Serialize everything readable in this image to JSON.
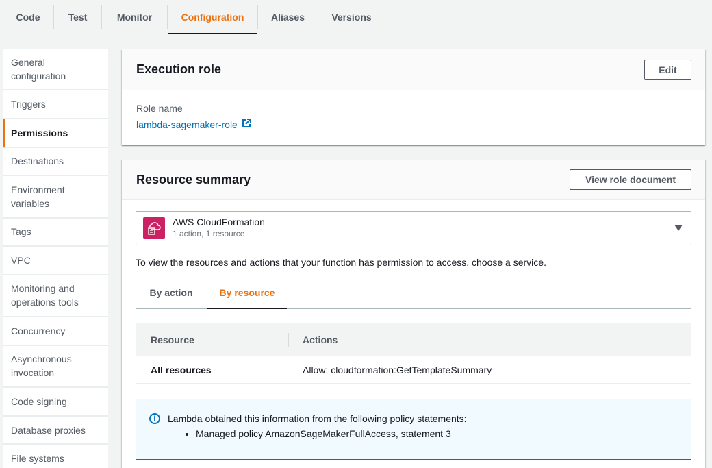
{
  "top_tabs": [
    {
      "label": "Code"
    },
    {
      "label": "Test"
    },
    {
      "label": "Monitor"
    },
    {
      "label": "Configuration"
    },
    {
      "label": "Aliases"
    },
    {
      "label": "Versions"
    }
  ],
  "sidebar": {
    "items": [
      {
        "label": "General configuration"
      },
      {
        "label": "Triggers"
      },
      {
        "label": "Permissions"
      },
      {
        "label": "Destinations"
      },
      {
        "label": "Environment variables"
      },
      {
        "label": "Tags"
      },
      {
        "label": "VPC"
      },
      {
        "label": "Monitoring and operations tools"
      },
      {
        "label": "Concurrency"
      },
      {
        "label": "Asynchronous invocation"
      },
      {
        "label": "Code signing"
      },
      {
        "label": "Database proxies"
      },
      {
        "label": "File systems"
      }
    ]
  },
  "execution_role": {
    "title": "Execution role",
    "edit_label": "Edit",
    "role_name_label": "Role name",
    "role_name": "lambda-sagemaker-role"
  },
  "resource_summary": {
    "title": "Resource summary",
    "view_doc_label": "View role document",
    "service": {
      "name": "AWS CloudFormation",
      "summary": "1 action, 1 resource"
    },
    "help_text": "To view the resources and actions that your function has permission to access, choose a service.",
    "tabs": [
      {
        "label": "By action"
      },
      {
        "label": "By resource"
      }
    ],
    "table": {
      "columns": [
        "Resource",
        "Actions"
      ],
      "rows": [
        {
          "resource": "All resources",
          "action": "Allow: cloudformation:GetTemplateSummary"
        }
      ]
    },
    "alert": {
      "message": "Lambda obtained this information from the following policy statements:",
      "items": [
        "Managed policy AmazonSageMakerFullAccess, statement 3"
      ]
    }
  },
  "colors": {
    "accent": "#ec7211",
    "link": "#0073bb",
    "service_icon": "#cc2264"
  },
  "icons": {
    "external_link": "external-link-icon",
    "service": "cloudformation-icon",
    "dropdown": "caret-down-icon",
    "info": "info-icon"
  }
}
